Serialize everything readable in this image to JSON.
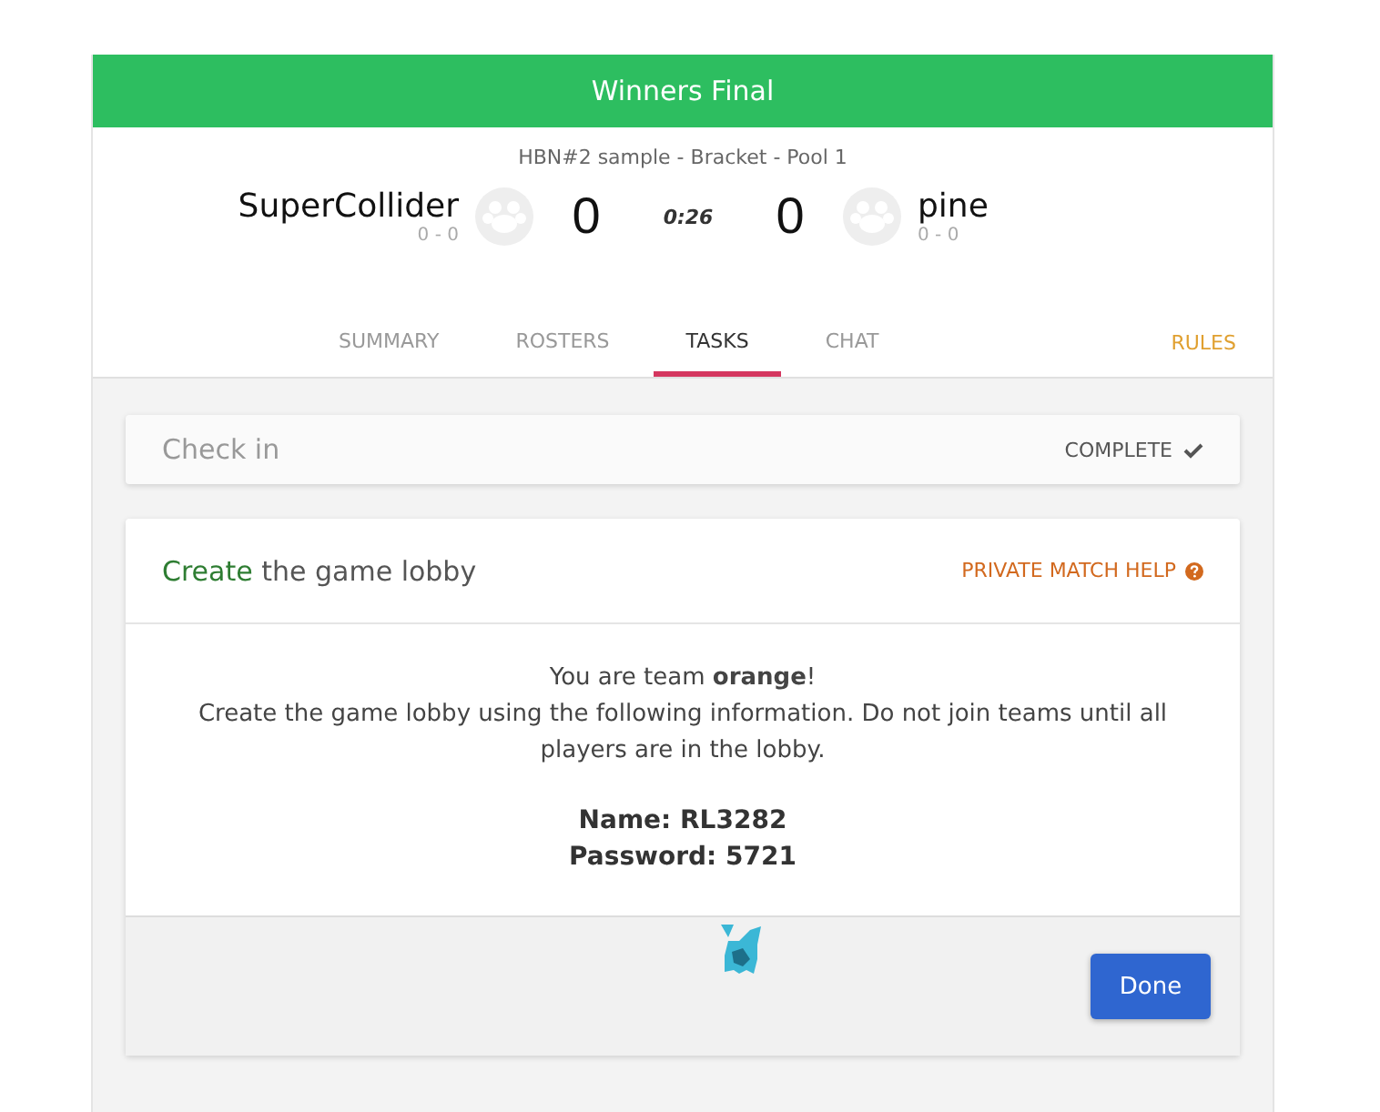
{
  "header": {
    "title": "Winners Final"
  },
  "match": {
    "subtitle": "HBN#2 sample - Bracket - Pool 1",
    "timer": "0:26",
    "teams": [
      {
        "name": "SuperCollider",
        "record": "0 - 0",
        "score": "0"
      },
      {
        "name": "pine",
        "record": "0 - 0",
        "score": "0"
      }
    ]
  },
  "tabs": [
    {
      "label": "SUMMARY",
      "selected": false
    },
    {
      "label": "ROSTERS",
      "selected": false
    },
    {
      "label": "TASKS",
      "selected": true
    },
    {
      "label": "CHAT",
      "selected": false
    }
  ],
  "rules_link": "RULES",
  "checkin": {
    "title": "Check in",
    "status": "COMPLETE",
    "complete": true
  },
  "lobby_task": {
    "title_highlight": "Create",
    "title_rest": "the game lobby",
    "help_link": "PRIVATE MATCH HELP",
    "team_line": "You are team **orange**!",
    "instructions": "Create the game lobby using the following information. Do not join teams until all players are in the lobby.",
    "lobby_name": "Name: RL3282",
    "password": "Password: 5721",
    "done_button": "Done"
  }
}
